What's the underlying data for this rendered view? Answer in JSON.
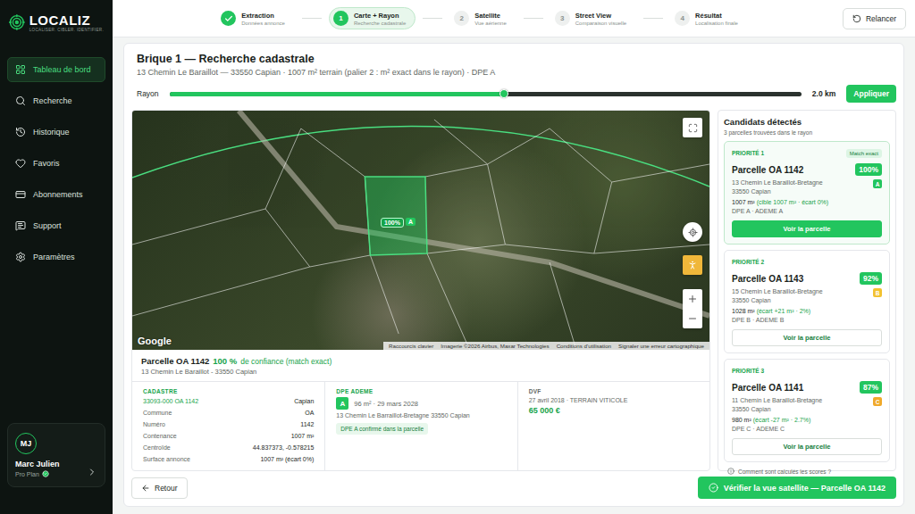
{
  "brand": {
    "name": "LOCALIZ",
    "tagline": "LOCALISER. CIBLER. IDENTIFIER."
  },
  "sidebar": {
    "items": [
      {
        "label": "Tableau de bord",
        "selected": true
      },
      {
        "label": "Recherche",
        "selected": false
      },
      {
        "label": "Historique",
        "selected": false
      },
      {
        "label": "Favoris",
        "selected": false
      },
      {
        "label": "Abonnements",
        "selected": false
      },
      {
        "label": "Support",
        "selected": false
      },
      {
        "label": "Paramètres",
        "selected": false
      }
    ]
  },
  "user": {
    "initials": "MJ",
    "name": "Marc Julien",
    "plan": "Pro Plan",
    "verified": true
  },
  "steps": [
    {
      "title": "Extraction",
      "subtitle": "Données annonce",
      "done": true,
      "selected": false
    },
    {
      "number": "1",
      "title": "Carte + Rayon",
      "subtitle": "Recherche cadastrale",
      "done": false,
      "selected": true
    },
    {
      "number": "2",
      "title": "Satellite",
      "subtitle": "Vue aérienne",
      "done": false,
      "selected": false
    },
    {
      "number": "3",
      "title": "Street View",
      "subtitle": "Comparaison visuelle",
      "done": false,
      "selected": false
    },
    {
      "number": "4",
      "title": "Résultat",
      "subtitle": "Localisation finale",
      "done": false,
      "selected": false
    }
  ],
  "restart_button": "Relancer",
  "page": {
    "title": "Brique 1 — Recherche cadastrale",
    "subtitle": "13 Chemin Le Baraillot — 33550 Capian · 1007 m² terrain (palier 2 : m² exact dans le rayon) · DPE A"
  },
  "radius": {
    "label": "Rayon",
    "level": 0.53,
    "reading": "2.0 km",
    "button": "Appliquer"
  },
  "map": {
    "parcel_score": "100%",
    "parcel_grade": "A",
    "logo": "Google",
    "attributions": [
      "Raccourcis clavier",
      "Imagerie ©2026 Airbus, Maxar Technologies",
      "Conditions d'utilisation",
      "Signaler une erreur cartographique"
    ]
  },
  "details": {
    "title": "Parcelle OA 1142",
    "score": "100 %",
    "score_note": "de confiance (match exact)",
    "address": "13 Chemin Le Baraillot - 33550 Capian",
    "cadastre": {
      "label": "CADASTRE",
      "code": "33093-000 OA 1142",
      "commune": "Capian",
      "rows": [
        {
          "label": "Commune",
          "value": "OA"
        },
        {
          "label": "Numéro",
          "value": "1142"
        },
        {
          "label": "Contenance",
          "value": "1007 m²"
        },
        {
          "label": "Centroïde",
          "value": "44.837373, -0.578215"
        },
        {
          "label": "Surface annonce",
          "value": "1007 m² (écart 0%)"
        }
      ]
    },
    "dpe": {
      "label": "DPE ADEME",
      "grade": "A",
      "info": "96 m² · 29 mars 2028",
      "address": "13 Chemin Le Barraillot-Bretagne 33550 Capian",
      "chip": "DPE A confirmé dans la parcelle"
    },
    "dvf": {
      "label": "DVF",
      "info": "27 avril 2018 · TERRAIN VITICOLE",
      "price": "65 000 €"
    }
  },
  "candidates": {
    "title": "Candidats détectés",
    "count": "3 parcelles trouvées dans le rayon",
    "help": "Comment sont calculés les scores ?",
    "items": [
      {
        "priority": "PRIORITÉ 1",
        "tag": "Match exact",
        "name": "Parcelle OA 1142",
        "score": "100%",
        "address": "13 Chemin Le Baraillot-Bretagne",
        "city": "33550 Capian",
        "grade": "A",
        "color": "#22c55e",
        "area": "1007 m²",
        "delta": "(cible 1007 m² · écart 0%)",
        "dpe": "DPE A · ADEME A",
        "button": "Voir la parcelle",
        "selected": true
      },
      {
        "priority": "PRIORITÉ 2",
        "name": "Parcelle OA 1143",
        "score": "92%",
        "address": "15 Chemin Le Baraillot-Bretagne",
        "city": "33550 Capian",
        "grade": "B",
        "color": "#f2c230",
        "area": "1028 m²",
        "delta": "(écart +21 m² · 2%)",
        "dpe": "DPE B · ADEME B",
        "button": "Voir la parcelle",
        "selected": false
      },
      {
        "priority": "PRIORITÉ 3",
        "name": "Parcelle OA 1141",
        "score": "87%",
        "address": "11 Chemin Le Baraillot-Bretagne",
        "city": "33550 Capian",
        "grade": "C",
        "color": "#f0a92a",
        "area": "980 m²",
        "delta": "(écart -27 m² · 2.7%)",
        "dpe": "DPE C · ADEME C",
        "button": "Voir la parcelle",
        "selected": false
      }
    ]
  },
  "footer": {
    "back": "Retour",
    "verify": "Vérifier la vue satellite — Parcelle OA 1142"
  }
}
